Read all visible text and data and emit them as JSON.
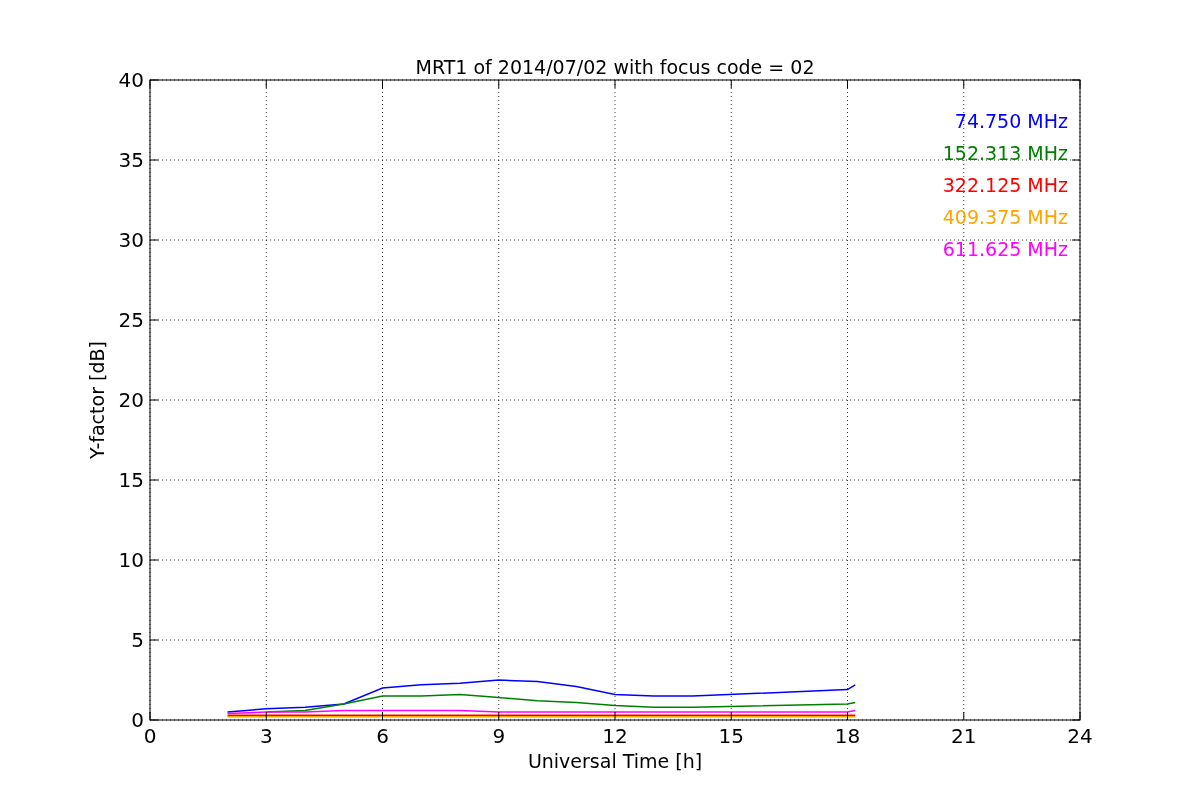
{
  "chart_data": {
    "type": "line",
    "title": "MRT1 of 2014/07/02 with focus code = 02",
    "xlabel": "Universal Time [h]",
    "ylabel": "Y-factor [dB]",
    "x": [
      2,
      3,
      4,
      5,
      6,
      7,
      8,
      9,
      10,
      11,
      12,
      13,
      14,
      18,
      18.2
    ],
    "series": [
      {
        "name": "74.750 MHz",
        "color": "#0000ff",
        "values": [
          0.5,
          0.7,
          0.8,
          1.0,
          2.0,
          2.2,
          2.3,
          2.5,
          2.4,
          2.1,
          1.6,
          1.5,
          1.5,
          1.9,
          2.2
        ]
      },
      {
        "name": "152.313 MHz",
        "color": "#008000",
        "values": [
          null,
          0.5,
          0.6,
          1.0,
          1.5,
          1.5,
          1.6,
          1.4,
          1.2,
          1.1,
          0.9,
          0.8,
          0.8,
          1.0,
          1.1
        ]
      },
      {
        "name": "322.125 MHz",
        "color": "#ff0000",
        "values": [
          0.3,
          0.3,
          0.3,
          0.3,
          0.3,
          0.3,
          0.3,
          0.3,
          0.3,
          0.3,
          0.3,
          0.3,
          0.3,
          0.3,
          0.3
        ]
      },
      {
        "name": "409.375 MHz",
        "color": "#ffa500",
        "values": [
          0.2,
          0.2,
          0.2,
          0.2,
          0.2,
          0.2,
          0.2,
          0.2,
          0.2,
          0.2,
          0.2,
          0.2,
          0.2,
          0.2,
          0.2
        ]
      },
      {
        "name": "611.625 MHz",
        "color": "#ff00ff",
        "values": [
          0.4,
          0.5,
          0.5,
          0.6,
          0.6,
          0.6,
          0.6,
          0.5,
          0.5,
          0.5,
          0.5,
          0.5,
          0.5,
          0.5,
          0.6
        ]
      }
    ],
    "grid": true,
    "xlim": [
      0,
      24
    ],
    "ylim": [
      0,
      40
    ],
    "xticks": [
      0,
      3,
      6,
      9,
      12,
      15,
      18,
      21,
      24
    ],
    "yticks": [
      0,
      5,
      10,
      15,
      20,
      25,
      30,
      35,
      40
    ]
  }
}
